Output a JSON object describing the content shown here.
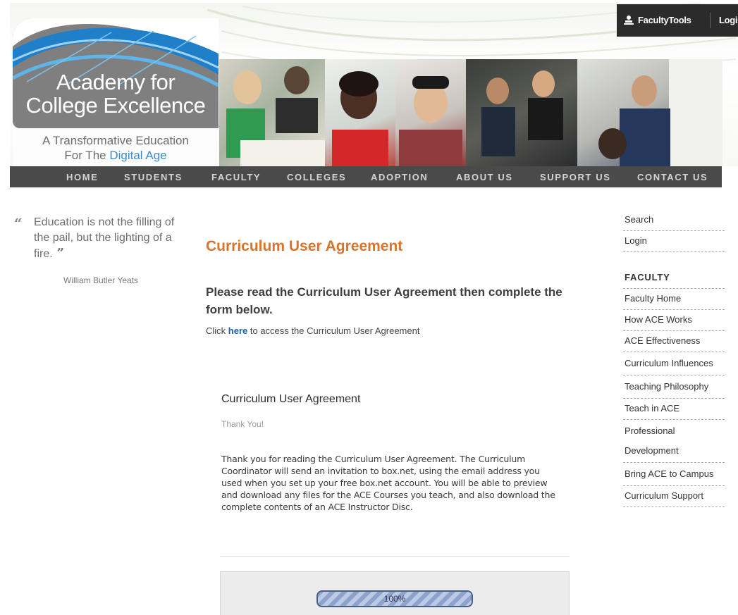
{
  "top_tools": {
    "faculty_tools": "FacultyTools",
    "login": "Login"
  },
  "logo": {
    "name_line1": "Academy for",
    "name_line2": "College Excellence",
    "tagline_line1": "A Transformative Education",
    "tagline_line2_prefix": "For The ",
    "tagline_line2_highlight": "Digital Age"
  },
  "nav": {
    "items": [
      "HOME",
      "STUDENTS",
      "FACULTY",
      "COLLEGES",
      "ADOPTION",
      "ABOUT US",
      "SUPPORT US",
      "CONTACT US"
    ]
  },
  "quote": {
    "open_mark": "“",
    "text": "Education is not the filling of the pail, but the lighting of a fire.",
    "close_mark": "”",
    "author": "William Butler Yeats"
  },
  "main": {
    "title": "Curriculum User Agreement",
    "intro": "Please read the Curriculum User Agreement then complete the form below.",
    "click_prefix": "Click ",
    "click_link": "here",
    "click_suffix": " to access the Curriculum User Agreement",
    "form_title": "Curriculum User Agreement",
    "thanks": "Thank You!",
    "body": "Thank you for reading the Curriculum User Agreement. The Curriculum Coordinator will send an invitation to box.net, using the email address you used when you set up your free box.net account. You will be able to preview and download any files for the ACE Courses you teach, and also download the complete contents of an ACE Instructor Disc.",
    "progress_label": "100%",
    "progress_value": 1.0
  },
  "sidebar": {
    "search": "Search",
    "login": "Login",
    "heading": "FACULTY",
    "links": [
      "Faculty Home",
      "How ACE Works",
      "ACE Effectiveness",
      "Curriculum Influences",
      "Teaching Philosophy",
      "Teach in ACE",
      "Professional Development",
      "Bring ACE to Campus",
      "Curriculum Support"
    ]
  },
  "colors": {
    "accent_orange": "#d9742b",
    "link_blue": "#1d5fa8",
    "nav_bg": "#4a4a4a",
    "logo_gray": "#7f7f7f",
    "logo_blue": "#3a8bc9"
  }
}
